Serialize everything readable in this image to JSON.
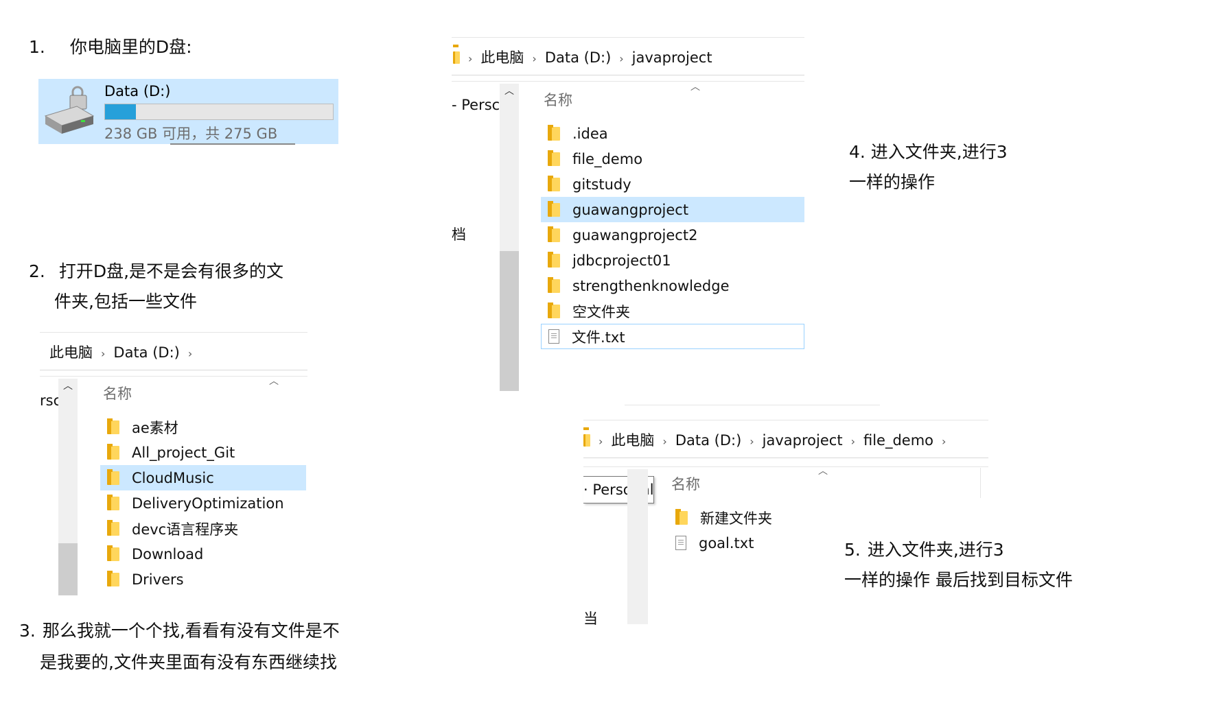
{
  "steps": {
    "s1": {
      "num": "1.",
      "text": "你电脑里的D盘:"
    },
    "s2": {
      "num": "2.",
      "line1": "打开D盘,是不是会有很多的文",
      "line2": "件夹,包括一些文件"
    },
    "s3": {
      "num": "3.",
      "line1": "那么我就一个个找,看看有没有文件是不",
      "line2": "是我要的,文件夹里面有没有东西继续找"
    },
    "s4": {
      "line1": "4. 进入文件夹,进行3",
      "line2": "一样的操作"
    },
    "s5": {
      "num": "5.",
      "line1": "进入文件夹,进行3",
      "line2": "一样的操作  最后找到目标文件"
    }
  },
  "drive": {
    "name": "Data (D:)",
    "usage": "238 GB 可用，共 275 GB",
    "used_fraction": 0.135,
    "icon": "hard-drive-lock-icon"
  },
  "explorer1": {
    "breadcrumb": [
      "此电脑",
      "Data (D:)"
    ],
    "nav_fragment": "rsc",
    "column": "名称",
    "items": [
      {
        "name": "ae素材",
        "type": "folder"
      },
      {
        "name": "All_project_Git",
        "type": "folder"
      },
      {
        "name": "CloudMusic",
        "type": "folder",
        "selected": true
      },
      {
        "name": "DeliveryOptimization",
        "type": "folder"
      },
      {
        "name": "devc语言程序夹",
        "type": "folder"
      },
      {
        "name": "Download",
        "type": "folder"
      },
      {
        "name": "Drivers",
        "type": "folder"
      }
    ]
  },
  "explorer2": {
    "breadcrumb": [
      "此电脑",
      "Data (D:)",
      "javaproject"
    ],
    "nav_fragment_1": "- Persc",
    "nav_fragment_2": "档",
    "column": "名称",
    "items": [
      {
        "name": ".idea",
        "type": "folder"
      },
      {
        "name": "file_demo",
        "type": "folder"
      },
      {
        "name": "gitstudy",
        "type": "folder"
      },
      {
        "name": "guawangproject",
        "type": "folder",
        "selected": true
      },
      {
        "name": "guawangproject2",
        "type": "folder"
      },
      {
        "name": "jdbcproject01",
        "type": "folder"
      },
      {
        "name": "strengthenknowledge",
        "type": "folder"
      },
      {
        "name": "空文件夹",
        "type": "folder"
      },
      {
        "name": "文件.txt",
        "type": "file",
        "focused": true
      }
    ]
  },
  "explorer3": {
    "breadcrumb": [
      "此电脑",
      "Data (D:)",
      "javaproject",
      "file_demo"
    ],
    "nav_fragment_1": "· Personal",
    "nav_fragment_2": "当",
    "column": "名称",
    "items": [
      {
        "name": "新建文件夹",
        "type": "folder"
      },
      {
        "name": "goal.txt",
        "type": "file"
      }
    ]
  },
  "colors": {
    "selection": "#cce8ff",
    "drive_bar_fill": "#26a0da",
    "folder": "#ffd65c"
  }
}
